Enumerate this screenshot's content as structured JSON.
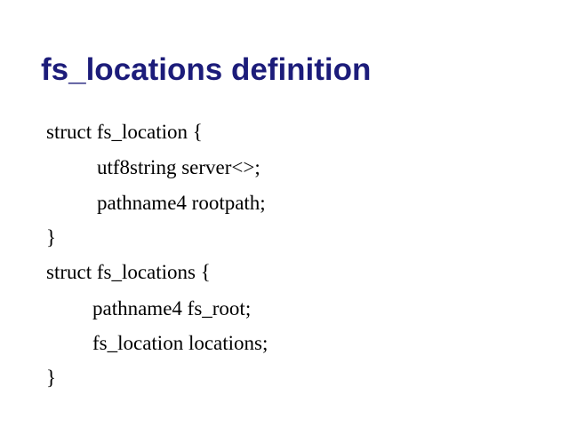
{
  "slide": {
    "title": "fs_locations definition",
    "code_lines": [
      "struct fs_location {",
      "utf8string server<>;",
      "pathname4 rootpath;",
      "}",
      "struct fs_locations {",
      "pathname4 fs_root;",
      "fs_location locations;",
      "}"
    ]
  },
  "colors": {
    "title": "#1c1c7a",
    "body_text": "#000000",
    "background": "#ffffff"
  }
}
